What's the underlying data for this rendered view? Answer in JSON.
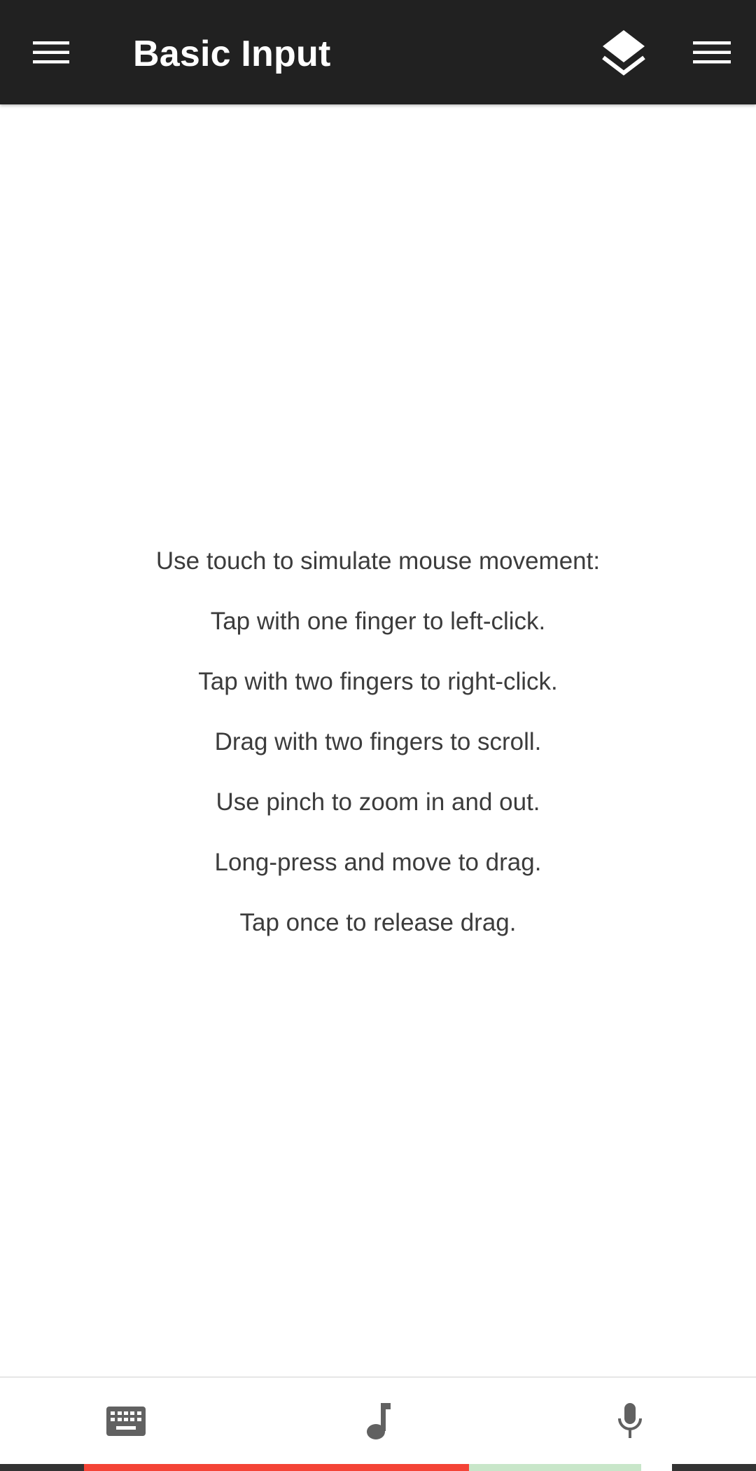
{
  "app_bar": {
    "title": "Basic Input",
    "background": "#212121",
    "left_icon": "hamburger-menu-icon",
    "right_icons": [
      "layers-icon",
      "overflow-menu-icon"
    ]
  },
  "instructions": [
    "Use touch to simulate mouse movement:",
    "Tap with one finger to left-click.",
    "Tap with two fingers to right-click.",
    "Drag with two fingers to scroll.",
    "Use pinch to zoom in and out.",
    "Long-press and move to drag.",
    "Tap once to release drag."
  ],
  "bottom_bar": {
    "buttons": [
      "keyboard-icon",
      "music-note-icon",
      "microphone-icon"
    ],
    "icon_color": "#616161"
  },
  "status_strip": {
    "colors": [
      "#333333",
      "#f44336",
      "#c8e6c9",
      "#ffffff",
      "#333333"
    ]
  }
}
